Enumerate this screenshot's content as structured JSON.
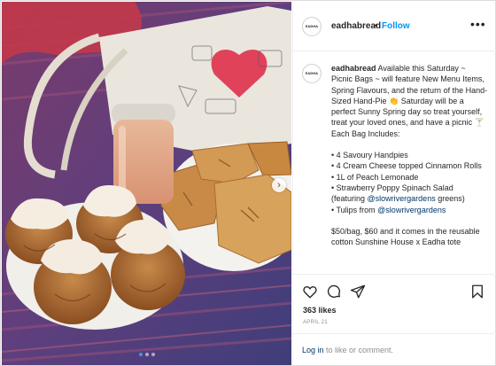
{
  "post": {
    "username": "eadhabread",
    "separator": "•",
    "follow_label": "Follow",
    "more_label": "•••",
    "avatar_logo": "EADHA",
    "caption_intro": "Available this Saturday ~ Picnic Bags ~ will feature New Menu Items, Spring Flavours, and the return of the Hand-Sized Hand-Pie 👏 Saturday will be a perfect Sunny Spring day so treat yourself, treat your loved ones, and have a picnic 🍸 Each Bag Includes:",
    "items": [
      "• 4 Savoury Handpies",
      "• 4 Cream Cheese topped Cinnamon Rolls",
      "• 1L of Peach Lemonade",
      "• Strawberry Poppy Spinach Salad (featuring ",
      "• Tulips from "
    ],
    "mention": "@slowrivergardens",
    "mention_suffix": " greens)",
    "price_text": "$50/bag, $60 and it comes in the reusable cotton Sunshine House x Eadha tote",
    "likes": "363 likes",
    "date": "APRIL 21",
    "login_link": "Log in",
    "login_rest": " to like or comment.",
    "carousel": {
      "count": 3,
      "active": 1,
      "next_symbol": "›"
    }
  },
  "icons": [
    "heart-icon",
    "comment-icon",
    "share-icon",
    "bookmark-icon",
    "chevron-right-icon"
  ]
}
